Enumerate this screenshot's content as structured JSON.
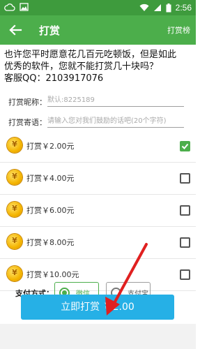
{
  "status_bar": {
    "time": "2:56"
  },
  "toolbar": {
    "title": "打赏",
    "ranking_label": "打赏榜"
  },
  "intro": {
    "line1": "也许您平时愿意花几百元吃顿饭，但是如此",
    "line2": "优秀的软件，您就不能打赏几十块吗？",
    "line3": "客服QQ：2103917076"
  },
  "form": {
    "nickname_label": "打赏昵称：",
    "nickname_placeholder": "默认:8225189",
    "message_label": "打赏寄语：",
    "message_placeholder": "请输入您对我们鼓励的话吧(20个字符)"
  },
  "tips": [
    {
      "label": "打赏￥2.00元",
      "checked": true
    },
    {
      "label": "打赏￥4.00元",
      "checked": false
    },
    {
      "label": "打赏￥6.00元",
      "checked": false
    },
    {
      "label": "打赏￥8.00元",
      "checked": false
    },
    {
      "label": "打赏￥10.00元",
      "checked": false
    }
  ],
  "payment": {
    "label": "支付方式：",
    "wechat": "微信",
    "alipay": "支付宝",
    "selected": "wechat"
  },
  "pay_button": {
    "label": "立即打赏 ￥2.00"
  },
  "colors": {
    "toolbar": "#4cae4b",
    "statusbar": "#3e9b3d",
    "pay_button": "#26b0e6",
    "annotation_arrow": "#e02020"
  }
}
